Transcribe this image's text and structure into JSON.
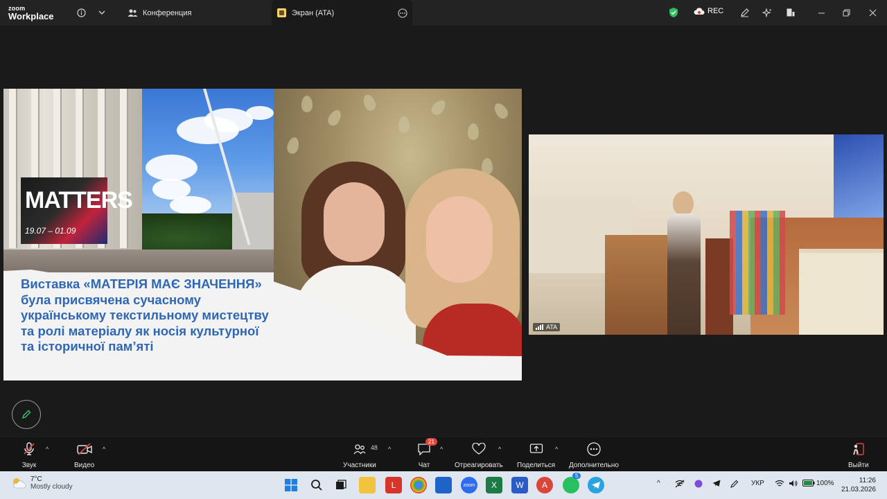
{
  "window": {
    "logo_top": "zoom",
    "logo_bottom": "Workplace",
    "tabs": [
      {
        "label": "Конференция",
        "active": false
      },
      {
        "label": "Экран (ATA)",
        "active": true
      }
    ],
    "rec_label": "REC",
    "colors": {
      "accent_green": "#3fc46b",
      "shield_green": "#2fbf5b"
    }
  },
  "share": {
    "banner_title": "MATTERS",
    "banner_dates": "19.07 – 01.09",
    "slide_lines": [
      "Виставка  «МАТЕРІЯ МАЄ ЗНАЧЕННЯ»",
      "була присвячена сучасному",
      "українському текстильному мистецтву",
      "та ролі матеріалу як носія культурної",
      "та історичної пам’яті"
    ],
    "text_color": "#2f67b5"
  },
  "camera": {
    "participant_name": "ATA"
  },
  "toolbar": {
    "audio_label": "Звук",
    "video_label": "Видео",
    "participants_label": "Участники",
    "participants_count": "48",
    "chat_label": "Чат",
    "chat_badge": "21",
    "react_label": "Отреагировать",
    "share_label": "Поделиться",
    "more_label": "Дополнительно",
    "leave_label": "Выйти"
  },
  "taskbar": {
    "weather_temp": "7°C",
    "weather_desc": "Mostly cloudy",
    "badge_telegram": "5",
    "language": "УКР",
    "battery": "100%",
    "time": "11:26",
    "date": "21.03.2026"
  }
}
